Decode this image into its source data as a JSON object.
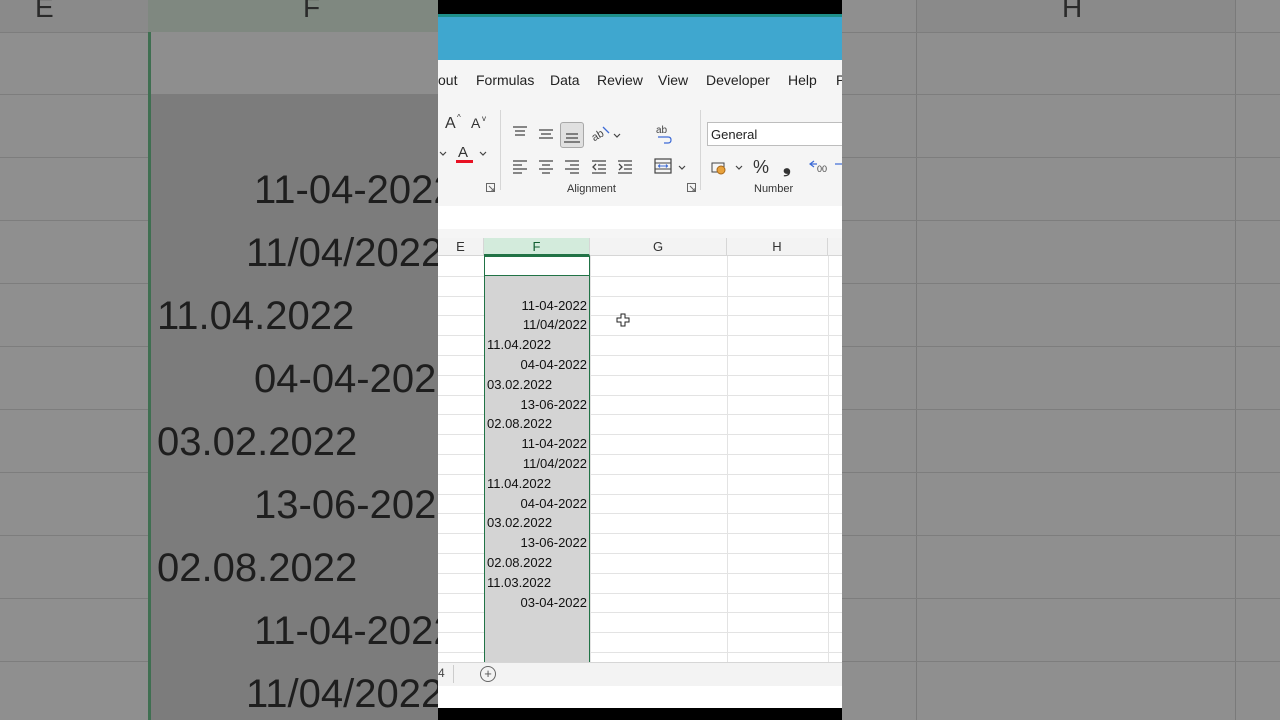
{
  "background": {
    "col_headers": [
      "E",
      "F",
      "H"
    ],
    "values": [
      "11-04-2022",
      "11/04/2022",
      "11.04.2022",
      "04-04-2022",
      "03.02.2022",
      "13-06-2022",
      "02.08.2022",
      "11-04-2022",
      "11/04/2022"
    ]
  },
  "menu": {
    "tabs": [
      "out",
      "Formulas",
      "Data",
      "Review",
      "View",
      "Developer",
      "Help",
      "P"
    ]
  },
  "ribbon": {
    "alignment_label": "Alignment",
    "number_label": "Number",
    "number_format": "General",
    "font_color": "#e81123",
    "percent_symbol": "%",
    "comma_symbol": "❟"
  },
  "grid": {
    "columns": [
      "E",
      "F",
      "G",
      "H"
    ],
    "selected_column": "F",
    "cells": [
      {
        "value": "",
        "align": "r"
      },
      {
        "value": "",
        "align": "r"
      },
      {
        "value": "11-04-2022",
        "align": "r"
      },
      {
        "value": "11/04/2022",
        "align": "r"
      },
      {
        "value": "11.04.2022",
        "align": "l"
      },
      {
        "value": "04-04-2022",
        "align": "r"
      },
      {
        "value": "03.02.2022",
        "align": "l"
      },
      {
        "value": "13-06-2022",
        "align": "r"
      },
      {
        "value": "02.08.2022",
        "align": "l"
      },
      {
        "value": "11-04-2022",
        "align": "r"
      },
      {
        "value": "11/04/2022",
        "align": "r"
      },
      {
        "value": "11.04.2022",
        "align": "l"
      },
      {
        "value": "04-04-2022",
        "align": "r"
      },
      {
        "value": "03.02.2022",
        "align": "l"
      },
      {
        "value": "13-06-2022",
        "align": "r"
      },
      {
        "value": "02.08.2022",
        "align": "l"
      },
      {
        "value": "11.03.2022",
        "align": "l"
      },
      {
        "value": "03-04-2022",
        "align": "r"
      }
    ],
    "accent_color": "#217346"
  },
  "sheetbar": {
    "sheet_number": "4",
    "add_symbol": "+"
  }
}
